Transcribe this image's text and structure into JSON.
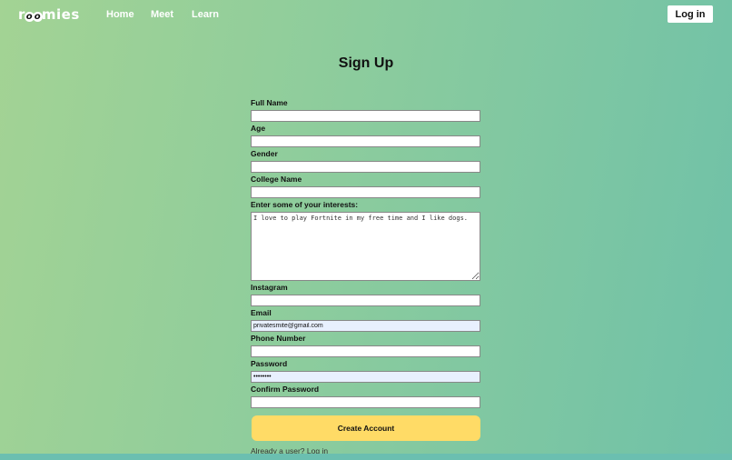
{
  "nav": {
    "logo": "roomies",
    "links": [
      "Home",
      "Meet",
      "Learn"
    ],
    "login_label": "Log in"
  },
  "page": {
    "title": "Sign Up"
  },
  "form": {
    "full_name": {
      "label": "Full Name",
      "value": ""
    },
    "age": {
      "label": "Age",
      "value": ""
    },
    "gender": {
      "label": "Gender",
      "value": ""
    },
    "college": {
      "label": "College Name",
      "value": ""
    },
    "interests": {
      "label": "Enter some of your interests:",
      "value": "I love to play Fortnite in my free time and I like dogs."
    },
    "instagram": {
      "label": "Instagram",
      "value": ""
    },
    "email": {
      "label": "Email",
      "value": "privatesmite@gmail.com"
    },
    "phone": {
      "label": "Phone Number",
      "value": ""
    },
    "password": {
      "label": "Password",
      "value": "••••••••"
    },
    "confirm_password": {
      "label": "Confirm Password",
      "value": ""
    },
    "submit_label": "Create Account",
    "login_link": "Already a user? Log in"
  },
  "colors": {
    "bg_start": "#a3d394",
    "bg_end": "#6fc1a8",
    "button": "#ffdb66",
    "autofill": "#e8f0fe"
  }
}
